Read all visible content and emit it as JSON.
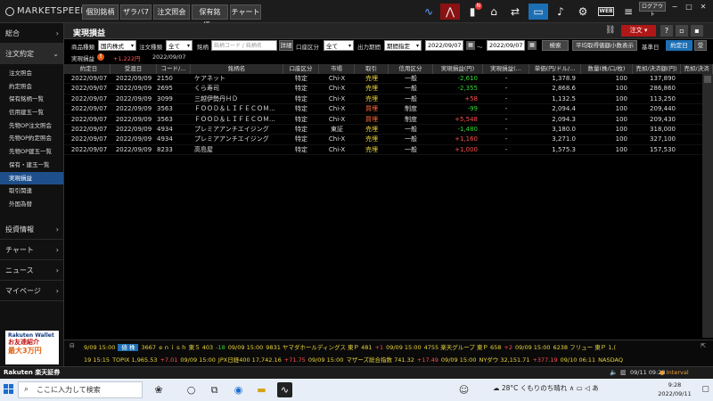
{
  "app": {
    "logo_text": "MARKETSPEED",
    "logo_suffix": "II",
    "tabs": [
      "個別銘柄",
      "ザラバ7",
      "注文照会",
      "保有銘柄...",
      "チャート"
    ],
    "logout_label": "ログアウト",
    "web_label": "WEB",
    "notify_badge": "N"
  },
  "sidebar": {
    "sections": [
      {
        "label": "総合",
        "open": false
      },
      {
        "label": "注文約定",
        "open": true
      }
    ],
    "sub_items": [
      "注文照会",
      "約定照会",
      "保有銘柄一覧",
      "信用建玉一覧",
      "先物OP注文照会",
      "先物OP約定照会",
      "先物OP建玉一覧",
      "保有・建玉一覧",
      "実現損益",
      "取引関連",
      "外国為替"
    ],
    "active_sub": "実現損益",
    "lower_sections": [
      "投資情報",
      "チャート",
      "ニュース",
      "マイページ"
    ],
    "promo": {
      "line1": "Rakuten Wallet",
      "line2": "お友達紹介",
      "line3": "最大3万円"
    }
  },
  "panel": {
    "title": "実現損益",
    "order_button": "注文",
    "help_button": "?",
    "filters": {
      "product_label": "商品種類",
      "product_value": "国内株式",
      "type_label": "注文種類",
      "type_value": "全て",
      "name_label": "銘柄",
      "name_placeholder": "銘柄コード / 銘柄名",
      "detail_button": "詳細",
      "account_label": "口座区分",
      "account_value": "全て",
      "period_label": "出力期間",
      "period_value": "期間指定",
      "date_from": "2022/09/07",
      "date_sep": "～",
      "date_to": "2022/09/07",
      "search_button": "検索",
      "avg_button": "平均取得価額小数表示",
      "base_date_label": "基準日",
      "base_exec_button": "約定日",
      "base_settle_button": "受"
    },
    "summary": {
      "label": "実現損益",
      "warn_icon": "!",
      "amount": "+1,222円",
      "date": "2022/09/07"
    },
    "columns": [
      "約定日",
      "受渡日",
      "コード/...",
      "銘柄名",
      "口座区分",
      "市場",
      "取引",
      "信用区分",
      "実現損益(円)",
      "実現損益(...",
      "単価(円/ドル/...",
      "数量(株/口/枚)",
      "売却/決済額(円)",
      "売却/決済"
    ],
    "rows": [
      {
        "exec_date": "2022/09/07",
        "settle_date": "2022/09/09",
        "code": "2150",
        "name": "ケアネット",
        "account": "特定",
        "market": "Chi-X",
        "trade": "売埋",
        "credit": "一般",
        "pnl": "-2,610",
        "pnl2": "-",
        "price": "1,378.9",
        "qty": "100",
        "amount": "137,890"
      },
      {
        "exec_date": "2022/09/07",
        "settle_date": "2022/09/09",
        "code": "2695",
        "name": "くら寿司",
        "account": "特定",
        "market": "Chi-X",
        "trade": "売埋",
        "credit": "一般",
        "pnl": "-2,355",
        "pnl2": "-",
        "price": "2,868.6",
        "qty": "100",
        "amount": "286,860"
      },
      {
        "exec_date": "2022/09/07",
        "settle_date": "2022/09/09",
        "code": "3099",
        "name": "三越伊勢丹ＨＤ",
        "account": "特定",
        "market": "Chi-X",
        "trade": "売埋",
        "credit": "一般",
        "pnl": "+58",
        "pnl2": "-",
        "price": "1,132.5",
        "qty": "100",
        "amount": "113,250"
      },
      {
        "exec_date": "2022/09/07",
        "settle_date": "2022/09/09",
        "code": "3563",
        "name": "ＦＯＯＤ＆ＬＩＦＥＣＯＭ...",
        "account": "特定",
        "market": "Chi-X",
        "trade": "買埋",
        "credit": "制度",
        "pnl": "-99",
        "pnl2": "-",
        "price": "2,094.4",
        "qty": "100",
        "amount": "209,440"
      },
      {
        "exec_date": "2022/09/07",
        "settle_date": "2022/09/09",
        "code": "3563",
        "name": "ＦＯＯＤ＆ＬＩＦＥＣＯＭ...",
        "account": "特定",
        "market": "Chi-X",
        "trade": "買埋",
        "credit": "制度",
        "pnl": "+5,548",
        "pnl2": "-",
        "price": "2,094.3",
        "qty": "100",
        "amount": "209,430"
      },
      {
        "exec_date": "2022/09/07",
        "settle_date": "2022/09/09",
        "code": "4934",
        "name": "プレミアアンチエイジング",
        "account": "特定",
        "market": "東証",
        "trade": "売埋",
        "credit": "一般",
        "pnl": "-1,480",
        "pnl2": "-",
        "price": "3,180.0",
        "qty": "100",
        "amount": "318,000"
      },
      {
        "exec_date": "2022/09/07",
        "settle_date": "2022/09/09",
        "code": "4934",
        "name": "プレミアアンチエイジング",
        "account": "特定",
        "market": "Chi-X",
        "trade": "売埋",
        "credit": "一般",
        "pnl": "+1,160",
        "pnl2": "-",
        "price": "3,271.0",
        "qty": "100",
        "amount": "327,100"
      },
      {
        "exec_date": "2022/09/07",
        "settle_date": "2022/09/09",
        "code": "8233",
        "name": "高島屋",
        "account": "特定",
        "market": "Chi-X",
        "trade": "売埋",
        "credit": "一般",
        "pnl": "+1,000",
        "pnl2": "-",
        "price": "1,575.3",
        "qty": "100",
        "amount": "157,530"
      }
    ]
  },
  "ticker": {
    "row1": [
      {
        "t": "9/09 15:00",
        "c": "y"
      },
      {
        "t": "値 株",
        "c": "tag"
      },
      {
        "t": "3667 ｅｎｉｓｈ 東Ｓ 403",
        "c": "y"
      },
      {
        "t": "-18",
        "c": "g"
      },
      {
        "t": "09/09 15:00",
        "c": "y"
      },
      {
        "t": "9831 ヤマダホールディングス 東Ｐ 481",
        "c": "y"
      },
      {
        "t": "+1",
        "c": "r"
      },
      {
        "t": "09/09 15:00",
        "c": "y"
      },
      {
        "t": "4755 楽天グループ 東Ｐ 658",
        "c": "y"
      },
      {
        "t": "+2",
        "c": "r"
      },
      {
        "t": "09/09 15:00",
        "c": "y"
      },
      {
        "t": "6238 フリュー 東Ｐ 1,(",
        "c": "y"
      }
    ],
    "row2": [
      {
        "t": "19 15:15",
        "c": "y"
      },
      {
        "t": "TOPIX 1,965.53",
        "c": "y"
      },
      {
        "t": "+7.01",
        "c": "r"
      },
      {
        "t": "09/09 15:00",
        "c": "y"
      },
      {
        "t": "JPX日経400 17,742.16",
        "c": "y"
      },
      {
        "t": "+71.75",
        "c": "r"
      },
      {
        "t": "09/09 15:00",
        "c": "y"
      },
      {
        "t": "マザーズ総合指数 741.32",
        "c": "y"
      },
      {
        "t": "+17.49",
        "c": "r"
      },
      {
        "t": "09/09 15:00",
        "c": "y"
      },
      {
        "t": "NYダウ 32,151.71",
        "c": "y"
      },
      {
        "t": "+377.19",
        "c": "r"
      },
      {
        "t": "09/10 06:11",
        "c": "y"
      },
      {
        "t": "NASDAQ",
        "c": "y"
      }
    ]
  },
  "status": {
    "broker": "Rakuten 楽天証券",
    "clock": "09/11 09:28",
    "interval": "Interval"
  },
  "taskbar": {
    "search_placeholder": "ここに入力して検索",
    "weather": "28°C くもりのち晴れ",
    "time": "9:28",
    "date": "2022/09/11"
  },
  "colors": {
    "accent": "#1c6fb4",
    "order_red": "#b01818",
    "profit": "#ff5050",
    "loss": "#33d633"
  }
}
